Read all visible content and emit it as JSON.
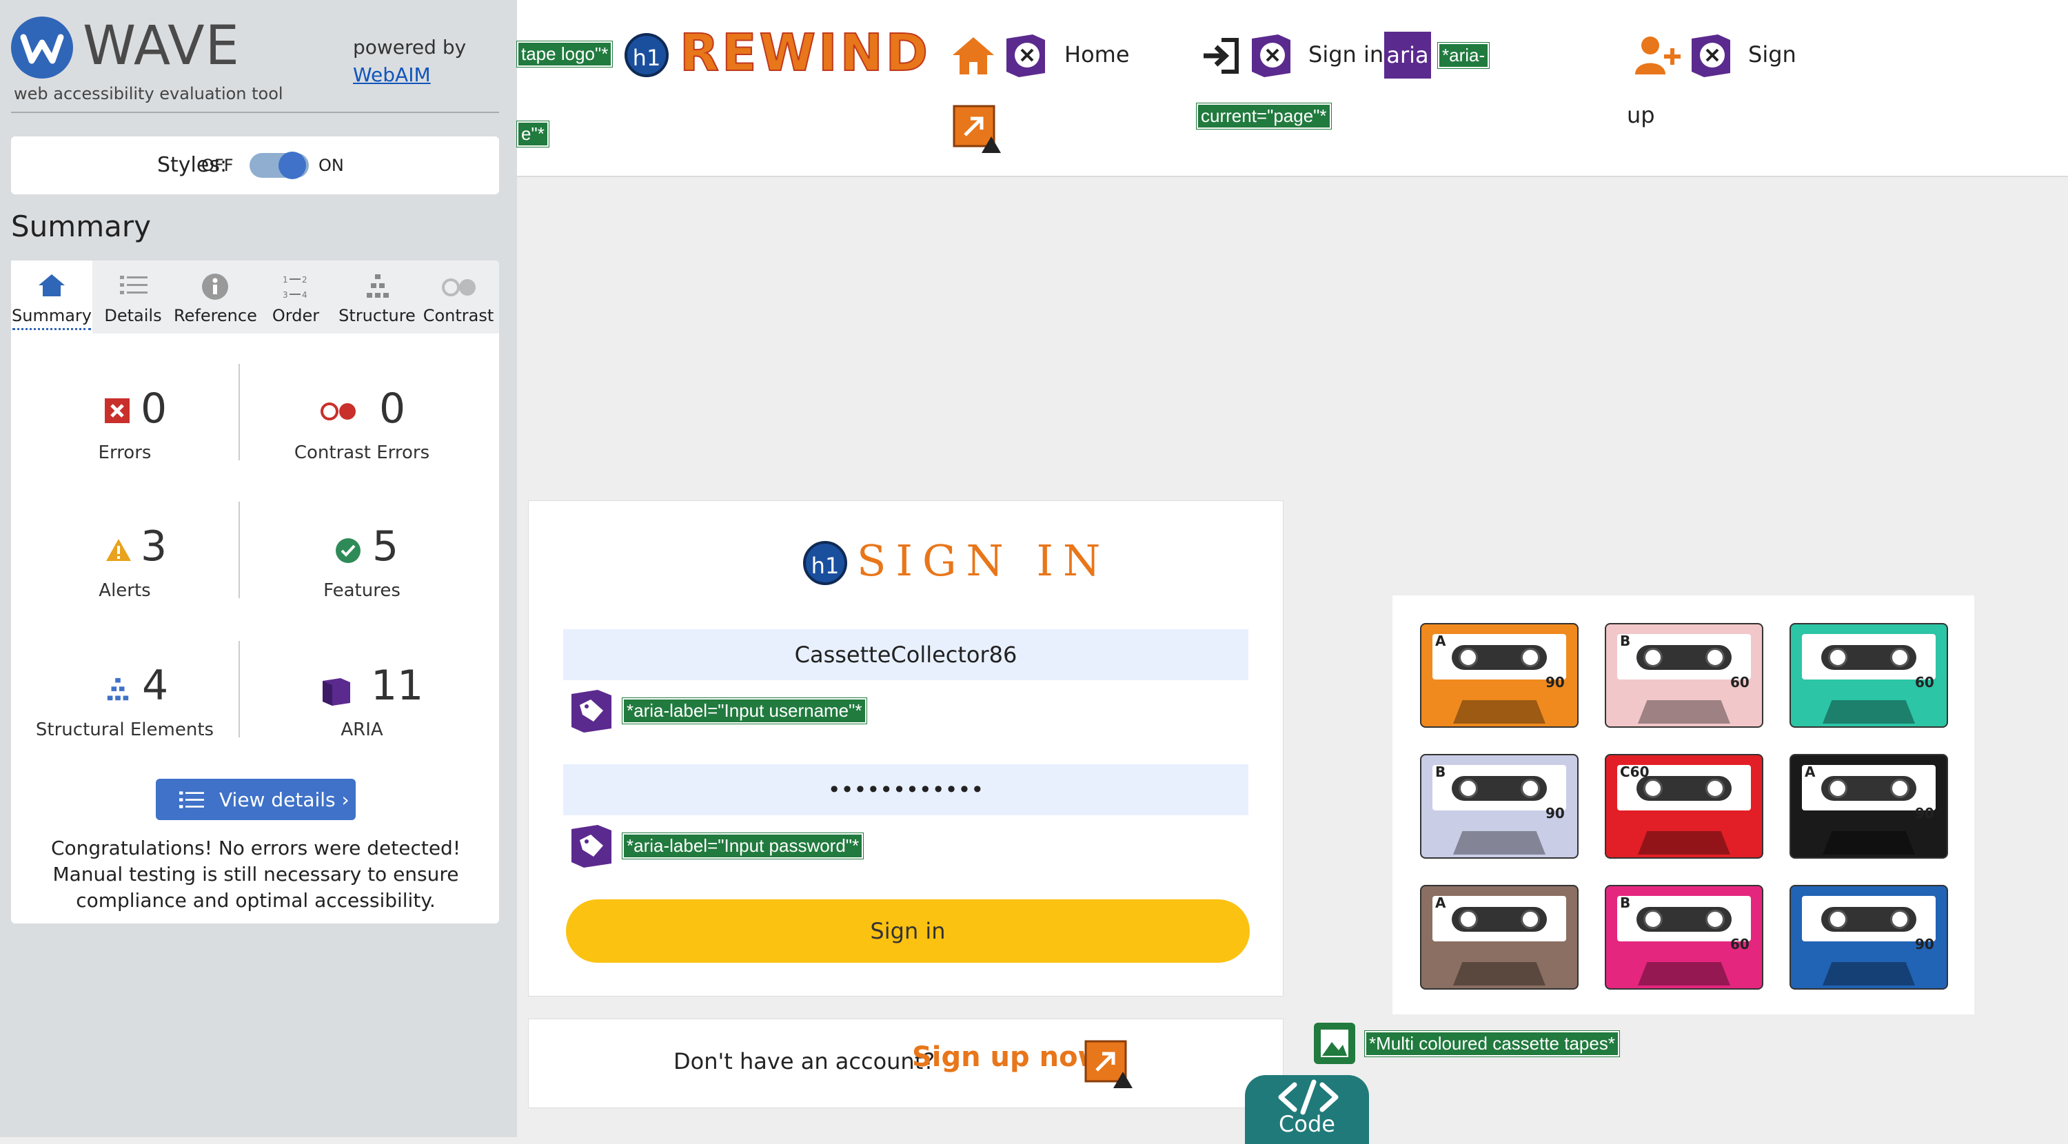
{
  "wave": {
    "brand": "WAVE",
    "tagline": "web accessibility evaluation tool",
    "powered_by": "powered by",
    "webaim": "WebAIM",
    "styles_label": "Styles:",
    "styles_off": "OFF",
    "styles_on": "ON",
    "summary_heading": "Summary",
    "tabs": [
      {
        "label": "Summary",
        "icon": "home-icon"
      },
      {
        "label": "Details",
        "icon": "list-icon"
      },
      {
        "label": "Reference",
        "icon": "info-icon"
      },
      {
        "label": "Order",
        "icon": "order-icon"
      },
      {
        "label": "Structure",
        "icon": "hierarchy-icon"
      },
      {
        "label": "Contrast",
        "icon": "contrast-icon"
      }
    ],
    "stats": {
      "errors": {
        "value": "0",
        "label": "Errors"
      },
      "contrast_errors": {
        "value": "0",
        "label": "Contrast Errors"
      },
      "alerts": {
        "value": "3",
        "label": "Alerts"
      },
      "features": {
        "value": "5",
        "label": "Features"
      },
      "structural": {
        "value": "4",
        "label": "Structural Elements"
      },
      "aria": {
        "value": "11",
        "label": "ARIA"
      }
    },
    "view_details": "View details ›",
    "congrats": "Congratulations! No errors were detected! Manual testing is still necessary to ensure compliance and optimal accessibility."
  },
  "site": {
    "logo_tag": "tape logo\"*",
    "logo_tag_tail": "e\"*",
    "logo_text": "REWIND",
    "h1": "h1",
    "nav": {
      "home": "Home",
      "signin": "Sign in",
      "aria": "aria",
      "aria_current_1": "*aria-",
      "aria_current_2": "current=\"page\"*",
      "signup_1": "Sign",
      "signup_2": "up"
    },
    "form": {
      "title": "SIGN IN",
      "username_value": "CassetteCollector86",
      "username_tag": "*aria-label=\"Input username\"*",
      "password_value": "••••••••••••",
      "password_tag": "*aria-label=\"Input password\"*",
      "submit": "Sign in"
    },
    "signup_prompt": "Don't have an account?",
    "signup_link": "Sign up now!",
    "image_alt_tag": "*Multi coloured cassette tapes*",
    "code_button": "Code",
    "cassettes": [
      {
        "color": "#f08a1e",
        "label": "A",
        "num": "90"
      },
      {
        "color": "#f2c7c9",
        "label": "B",
        "num": "60"
      },
      {
        "color": "#2cc5a6",
        "label": "",
        "num": "60"
      },
      {
        "color": "#c9cde6",
        "label": "B",
        "num": "90"
      },
      {
        "color": "#e21f26",
        "label": "C60",
        "num": ""
      },
      {
        "color": "#1a1a1a",
        "label": "A",
        "num": "90"
      },
      {
        "color": "#8a6f62",
        "label": "A",
        "num": ""
      },
      {
        "color": "#e5267f",
        "label": "B",
        "num": "60"
      },
      {
        "color": "#2163b5",
        "label": "",
        "num": "90"
      }
    ]
  }
}
